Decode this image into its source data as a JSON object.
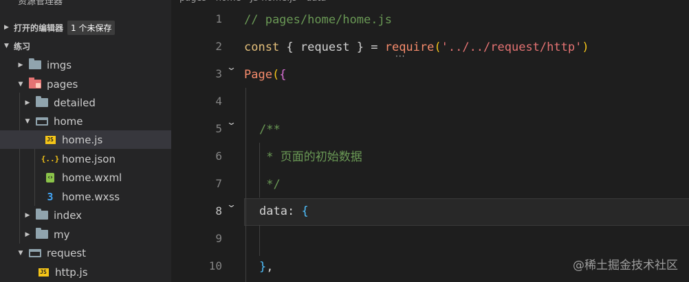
{
  "sidebar": {
    "title": "资源管理器",
    "more_icon": "ellipsis-icon",
    "open_editors": {
      "label": "打开的编辑器",
      "badge": "1 个未保存"
    },
    "workspace": {
      "label": "练习"
    },
    "tree": [
      {
        "label": "imgs",
        "icon": "folder-icon"
      },
      {
        "label": "pages",
        "icon": "folder-pages-icon"
      },
      {
        "label": "detailed",
        "icon": "folder-icon"
      },
      {
        "label": "home",
        "icon": "folder-open-icon"
      },
      {
        "label": "home.js",
        "icon": "js-file-icon"
      },
      {
        "label": "home.json",
        "icon": "json-file-icon"
      },
      {
        "label": "home.wxml",
        "icon": "wxml-file-icon"
      },
      {
        "label": "home.wxss",
        "icon": "wxss-file-icon"
      },
      {
        "label": "index",
        "icon": "folder-icon"
      },
      {
        "label": "my",
        "icon": "folder-icon"
      },
      {
        "label": "request",
        "icon": "folder-open-icon"
      },
      {
        "label": "http.js",
        "icon": "js-file-icon"
      }
    ]
  },
  "editor": {
    "breadcrumb": "pages › home › JS home.js › data",
    "line_numbers": [
      "1",
      "2",
      "3",
      "4",
      "5",
      "6",
      "7",
      "8",
      "9",
      "10"
    ],
    "code": {
      "l1": "// pages/home/home.js",
      "l2_kw": "const",
      "l2_a": " { request } = ",
      "l2_fn": "require",
      "l2_p1": "(",
      "l2_str": "'../../request/http'",
      "l2_p2": ")",
      "l3_fn": "Page",
      "l3_p": "(",
      "l3_b": "{",
      "l5": "/**",
      "l6": " * 页面的初始数据",
      "l7": " */",
      "l8_prop": "data",
      "l8_colon": ": ",
      "l8_b": "{",
      "l10_b": "}",
      "l10_c": ","
    }
  },
  "watermark": "@稀土掘金技术社区"
}
